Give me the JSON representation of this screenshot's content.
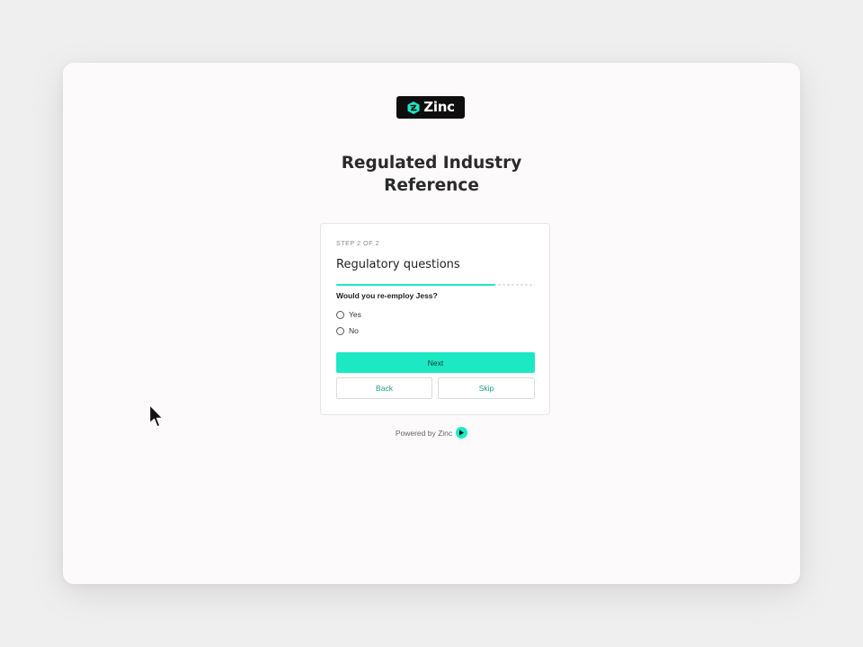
{
  "brand": {
    "logo_text": "Zinc",
    "accent_color": "#1de8c4",
    "logo_bg": "#0e0e0e"
  },
  "page": {
    "title": "Regulated Industry\nReference"
  },
  "form": {
    "step_label": "STEP 2 OF 2",
    "section_title": "Regulatory questions",
    "progress": 0.8,
    "question": "Would you re-employ Jess?",
    "options": [
      {
        "label": "Yes",
        "selected": false
      },
      {
        "label": "No",
        "selected": false
      }
    ],
    "next_label": "Next",
    "back_label": "Back",
    "skip_label": "Skip"
  },
  "footer": {
    "powered_by": "Powered by Zinc",
    "icon": "zinc-play-icon"
  },
  "pointer": {
    "icon": "mouse-pointer-icon"
  }
}
